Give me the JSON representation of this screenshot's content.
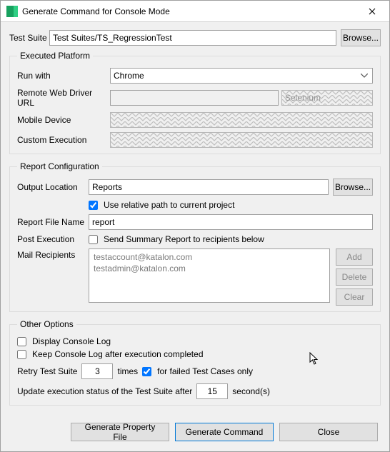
{
  "titlebar": {
    "title": "Generate Command for Console Mode"
  },
  "testSuite": {
    "label": "Test Suite",
    "value": "Test Suites/TS_RegressionTest",
    "browse": "Browse..."
  },
  "executedPlatform": {
    "legend": "Executed Platform",
    "runWith": {
      "label": "Run with",
      "value": "Chrome"
    },
    "remoteUrl": {
      "label": "Remote Web Driver URL",
      "value": "",
      "driver": "Selenium"
    },
    "mobileDevice": {
      "label": "Mobile Device",
      "value": ""
    },
    "customExecution": {
      "label": "Custom Execution",
      "value": ""
    }
  },
  "reportConfig": {
    "legend": "Report Configuration",
    "outputLocation": {
      "label": "Output Location",
      "value": "Reports",
      "browse": "Browse..."
    },
    "useRelative": {
      "label": "Use relative path to current project",
      "checked": true
    },
    "reportFileName": {
      "label": "Report File Name",
      "value": "report"
    },
    "postExecution": {
      "label": "Post Execution",
      "checkboxLabel": "Send Summary Report to recipients below",
      "checked": false
    },
    "mailRecipients": {
      "label": "Mail Recipients",
      "items": [
        "testaccount@katalon.com",
        "testadmin@katalon.com"
      ],
      "add": "Add",
      "delete": "Delete",
      "clear": "Clear"
    }
  },
  "otherOptions": {
    "legend": "Other Options",
    "displayConsoleLog": {
      "label": "Display Console Log",
      "checked": false
    },
    "keepConsoleLog": {
      "label": "Keep Console Log after execution completed",
      "checked": false
    },
    "retry": {
      "label": "Retry Test Suite",
      "count": "3",
      "timesLabel": "times",
      "failedOnlyLabel": "for failed Test Cases only",
      "failedOnlyChecked": true
    },
    "updateStatus": {
      "labelPrefix": "Update execution status of the Test Suite after",
      "value": "15",
      "labelSuffix": "second(s)"
    }
  },
  "footer": {
    "generatePropertyFile": "Generate Property File",
    "generateCommand": "Generate Command",
    "close": "Close"
  }
}
